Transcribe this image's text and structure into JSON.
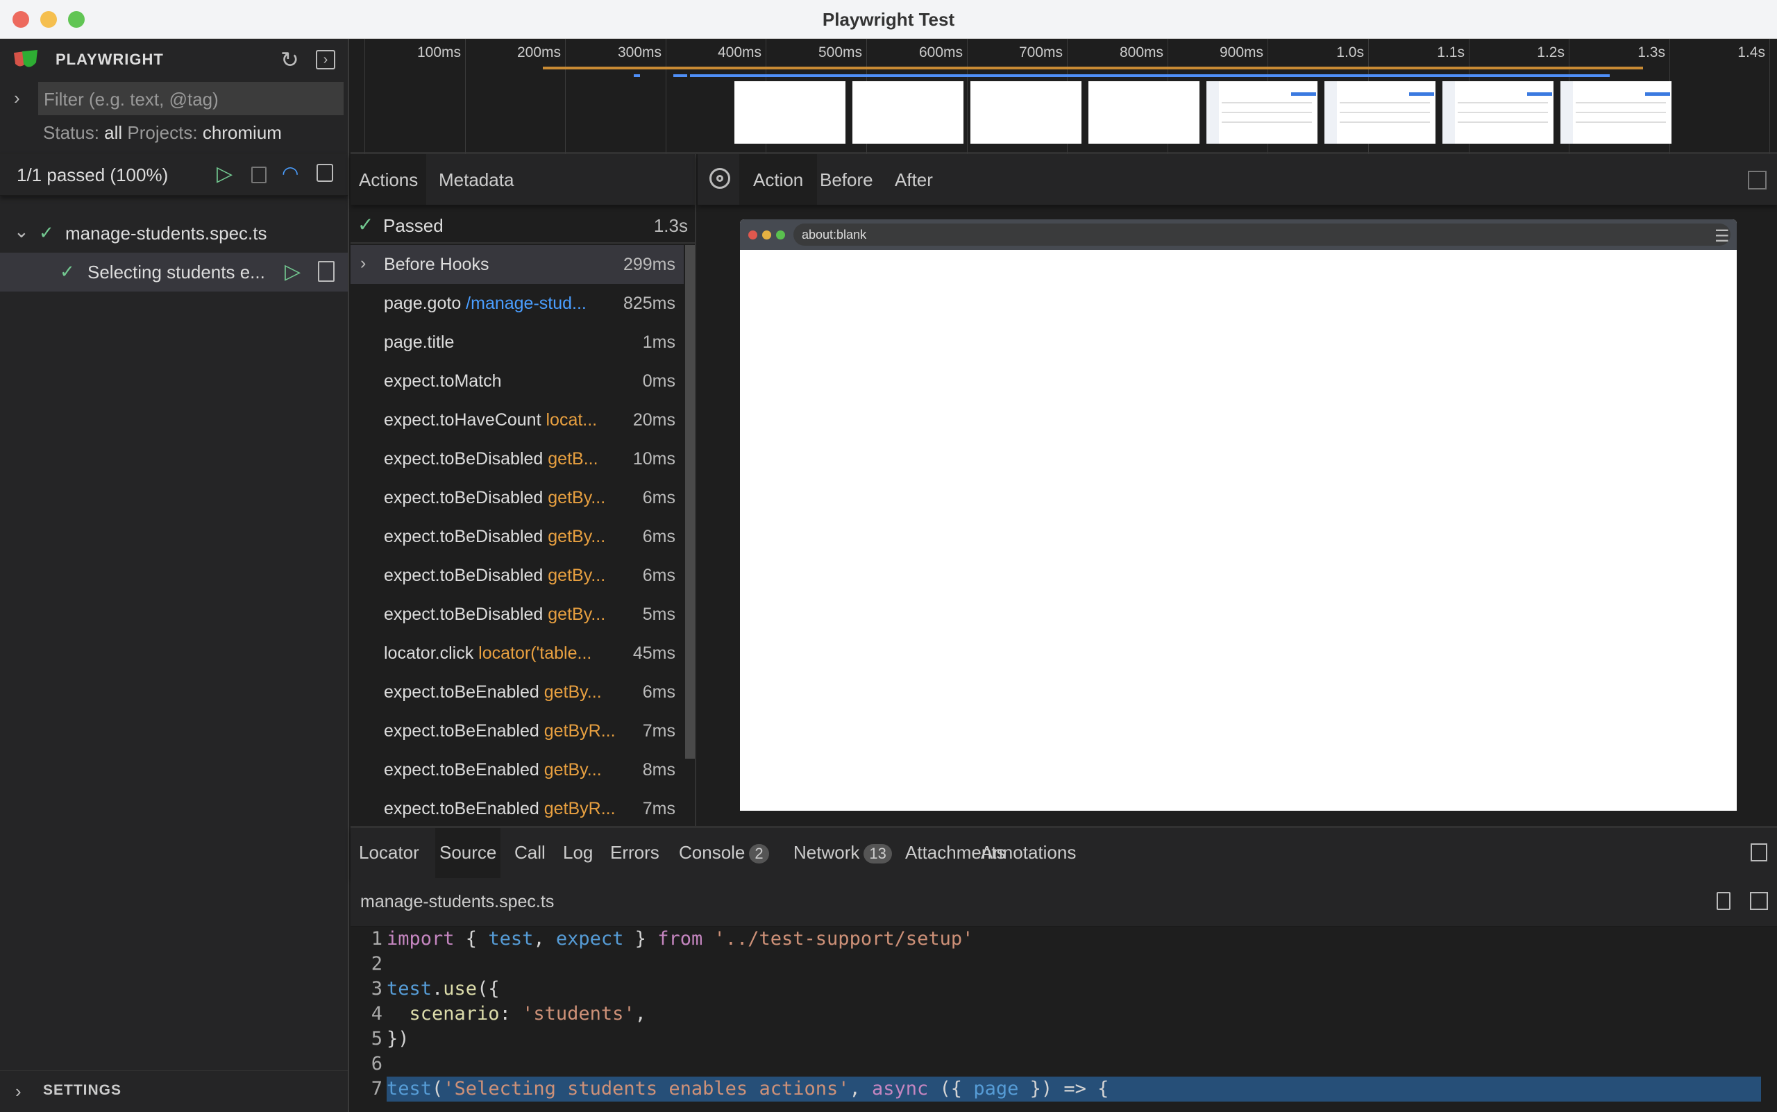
{
  "window": {
    "title": "Playwright Test"
  },
  "sidebar": {
    "brand": "PLAYWRIGHT",
    "filter_placeholder": "Filter (e.g. text, @tag)",
    "status_label": "Status:",
    "status_value": "all",
    "projects_label": "Projects:",
    "projects_value": "chromium",
    "summary": "1/1 passed (100%)",
    "tree": [
      {
        "label": "manage-students.spec.ts"
      },
      {
        "label": "Selecting students e..."
      }
    ],
    "settings": "SETTINGS"
  },
  "timeline": {
    "ticks": [
      "100ms",
      "200ms",
      "300ms",
      "400ms",
      "500ms",
      "600ms",
      "700ms",
      "800ms",
      "900ms",
      "1.0s",
      "1.1s",
      "1.2s",
      "1.3s",
      "1.4s"
    ]
  },
  "actions_pane": {
    "tabs": [
      "Actions",
      "Metadata"
    ],
    "result": {
      "label": "Passed",
      "time": "1.3s"
    },
    "items": [
      {
        "name": "Before Hooks",
        "arg": "",
        "time": "299ms",
        "expandable": true
      },
      {
        "name": "page.goto",
        "arg": "/manage-stud...",
        "time": "825ms",
        "link": true
      },
      {
        "name": "page.title",
        "arg": "",
        "time": "1ms"
      },
      {
        "name": "expect.toMatch",
        "arg": "",
        "time": "0ms"
      },
      {
        "name": "expect.toHaveCount",
        "arg": "locat...",
        "time": "20ms"
      },
      {
        "name": "expect.toBeDisabled",
        "arg": "getB...",
        "time": "10ms"
      },
      {
        "name": "expect.toBeDisabled",
        "arg": "getBy...",
        "time": "6ms"
      },
      {
        "name": "expect.toBeDisabled",
        "arg": "getBy...",
        "time": "6ms"
      },
      {
        "name": "expect.toBeDisabled",
        "arg": "getBy...",
        "time": "6ms"
      },
      {
        "name": "expect.toBeDisabled",
        "arg": "getBy...",
        "time": "5ms"
      },
      {
        "name": "locator.click",
        "arg": "locator('table...",
        "time": "45ms"
      },
      {
        "name": "expect.toBeEnabled",
        "arg": "getBy...",
        "time": "6ms"
      },
      {
        "name": "expect.toBeEnabled",
        "arg": "getByR...",
        "time": "7ms"
      },
      {
        "name": "expect.toBeEnabled",
        "arg": "getBy...",
        "time": "8ms"
      },
      {
        "name": "expect.toBeEnabled",
        "arg": "getByR...",
        "time": "7ms"
      }
    ]
  },
  "snapshot_pane": {
    "tabs": [
      "Action",
      "Before",
      "After"
    ],
    "url": "about:blank"
  },
  "bottom_panel": {
    "tabs": [
      {
        "label": "Locator"
      },
      {
        "label": "Source"
      },
      {
        "label": "Call"
      },
      {
        "label": "Log"
      },
      {
        "label": "Errors"
      },
      {
        "label": "Console",
        "badge": "2"
      },
      {
        "label": "Network",
        "badge": "13"
      },
      {
        "label": "Attachments"
      },
      {
        "label": "Annotations"
      }
    ],
    "file": "manage-students.spec.ts",
    "line_numbers": [
      "1",
      "2",
      "3",
      "4",
      "5",
      "6",
      "7"
    ]
  },
  "colors": {
    "accent": "#569cd6",
    "pass": "#73c991",
    "highlight": "#264f78",
    "timeline_orange": "#c98b34",
    "timeline_blue": "#4f8ff7"
  }
}
